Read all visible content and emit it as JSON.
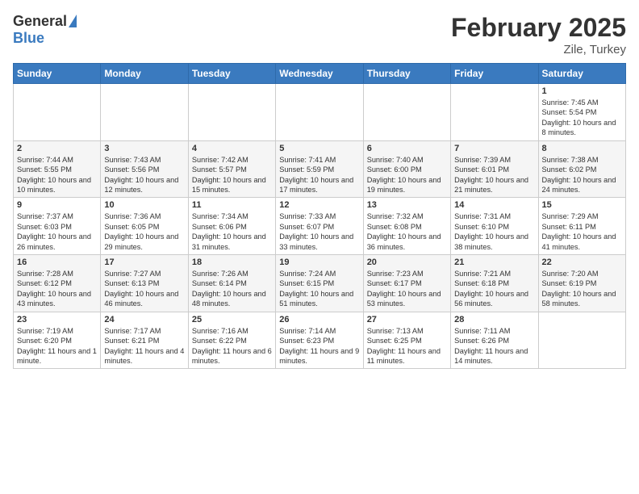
{
  "header": {
    "logo_general": "General",
    "logo_blue": "Blue",
    "month_title": "February 2025",
    "location": "Zile, Turkey"
  },
  "days_of_week": [
    "Sunday",
    "Monday",
    "Tuesday",
    "Wednesday",
    "Thursday",
    "Friday",
    "Saturday"
  ],
  "weeks": [
    [
      {
        "day": "",
        "info": ""
      },
      {
        "day": "",
        "info": ""
      },
      {
        "day": "",
        "info": ""
      },
      {
        "day": "",
        "info": ""
      },
      {
        "day": "",
        "info": ""
      },
      {
        "day": "",
        "info": ""
      },
      {
        "day": "1",
        "info": "Sunrise: 7:45 AM\nSunset: 5:54 PM\nDaylight: 10 hours and 8 minutes."
      }
    ],
    [
      {
        "day": "2",
        "info": "Sunrise: 7:44 AM\nSunset: 5:55 PM\nDaylight: 10 hours and 10 minutes."
      },
      {
        "day": "3",
        "info": "Sunrise: 7:43 AM\nSunset: 5:56 PM\nDaylight: 10 hours and 12 minutes."
      },
      {
        "day": "4",
        "info": "Sunrise: 7:42 AM\nSunset: 5:57 PM\nDaylight: 10 hours and 15 minutes."
      },
      {
        "day": "5",
        "info": "Sunrise: 7:41 AM\nSunset: 5:59 PM\nDaylight: 10 hours and 17 minutes."
      },
      {
        "day": "6",
        "info": "Sunrise: 7:40 AM\nSunset: 6:00 PM\nDaylight: 10 hours and 19 minutes."
      },
      {
        "day": "7",
        "info": "Sunrise: 7:39 AM\nSunset: 6:01 PM\nDaylight: 10 hours and 21 minutes."
      },
      {
        "day": "8",
        "info": "Sunrise: 7:38 AM\nSunset: 6:02 PM\nDaylight: 10 hours and 24 minutes."
      }
    ],
    [
      {
        "day": "9",
        "info": "Sunrise: 7:37 AM\nSunset: 6:03 PM\nDaylight: 10 hours and 26 minutes."
      },
      {
        "day": "10",
        "info": "Sunrise: 7:36 AM\nSunset: 6:05 PM\nDaylight: 10 hours and 29 minutes."
      },
      {
        "day": "11",
        "info": "Sunrise: 7:34 AM\nSunset: 6:06 PM\nDaylight: 10 hours and 31 minutes."
      },
      {
        "day": "12",
        "info": "Sunrise: 7:33 AM\nSunset: 6:07 PM\nDaylight: 10 hours and 33 minutes."
      },
      {
        "day": "13",
        "info": "Sunrise: 7:32 AM\nSunset: 6:08 PM\nDaylight: 10 hours and 36 minutes."
      },
      {
        "day": "14",
        "info": "Sunrise: 7:31 AM\nSunset: 6:10 PM\nDaylight: 10 hours and 38 minutes."
      },
      {
        "day": "15",
        "info": "Sunrise: 7:29 AM\nSunset: 6:11 PM\nDaylight: 10 hours and 41 minutes."
      }
    ],
    [
      {
        "day": "16",
        "info": "Sunrise: 7:28 AM\nSunset: 6:12 PM\nDaylight: 10 hours and 43 minutes."
      },
      {
        "day": "17",
        "info": "Sunrise: 7:27 AM\nSunset: 6:13 PM\nDaylight: 10 hours and 46 minutes."
      },
      {
        "day": "18",
        "info": "Sunrise: 7:26 AM\nSunset: 6:14 PM\nDaylight: 10 hours and 48 minutes."
      },
      {
        "day": "19",
        "info": "Sunrise: 7:24 AM\nSunset: 6:15 PM\nDaylight: 10 hours and 51 minutes."
      },
      {
        "day": "20",
        "info": "Sunrise: 7:23 AM\nSunset: 6:17 PM\nDaylight: 10 hours and 53 minutes."
      },
      {
        "day": "21",
        "info": "Sunrise: 7:21 AM\nSunset: 6:18 PM\nDaylight: 10 hours and 56 minutes."
      },
      {
        "day": "22",
        "info": "Sunrise: 7:20 AM\nSunset: 6:19 PM\nDaylight: 10 hours and 58 minutes."
      }
    ],
    [
      {
        "day": "23",
        "info": "Sunrise: 7:19 AM\nSunset: 6:20 PM\nDaylight: 11 hours and 1 minute."
      },
      {
        "day": "24",
        "info": "Sunrise: 7:17 AM\nSunset: 6:21 PM\nDaylight: 11 hours and 4 minutes."
      },
      {
        "day": "25",
        "info": "Sunrise: 7:16 AM\nSunset: 6:22 PM\nDaylight: 11 hours and 6 minutes."
      },
      {
        "day": "26",
        "info": "Sunrise: 7:14 AM\nSunset: 6:23 PM\nDaylight: 11 hours and 9 minutes."
      },
      {
        "day": "27",
        "info": "Sunrise: 7:13 AM\nSunset: 6:25 PM\nDaylight: 11 hours and 11 minutes."
      },
      {
        "day": "28",
        "info": "Sunrise: 7:11 AM\nSunset: 6:26 PM\nDaylight: 11 hours and 14 minutes."
      },
      {
        "day": "",
        "info": ""
      }
    ]
  ]
}
